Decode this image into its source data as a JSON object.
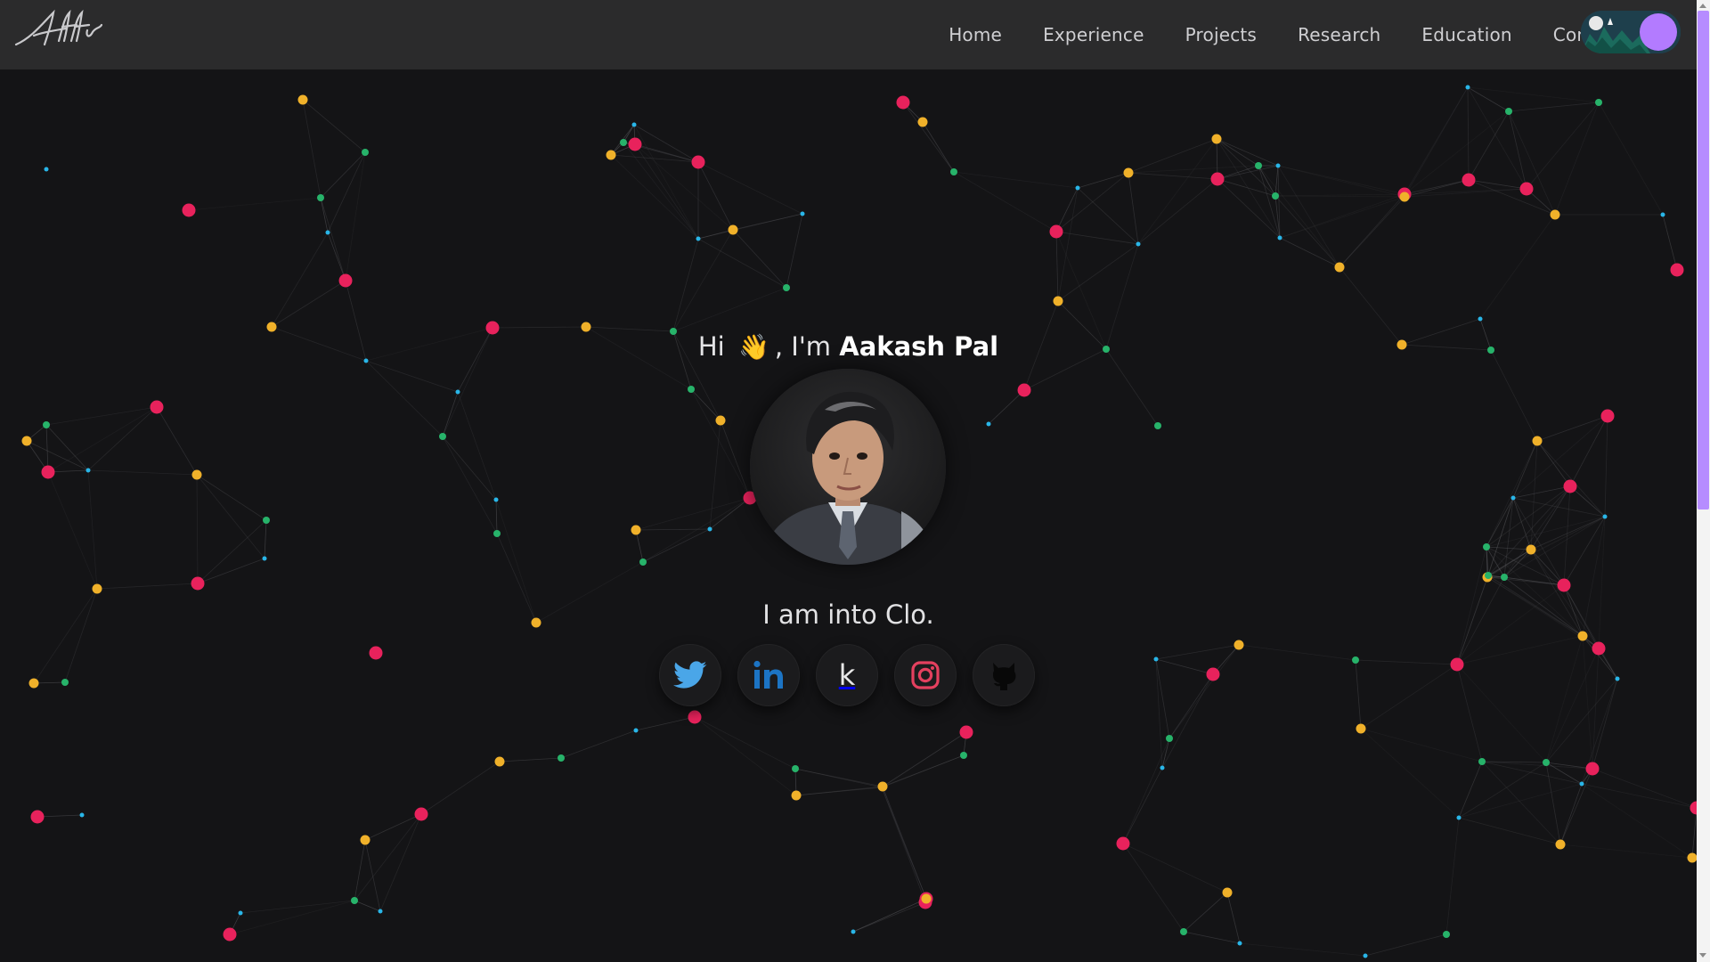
{
  "brand": {
    "logo_text": "Affi"
  },
  "nav": {
    "items": [
      "Home",
      "Experience",
      "Projects",
      "Research",
      "Education",
      "Contact"
    ]
  },
  "theme_toggle": {
    "state": "dark"
  },
  "hero": {
    "greeting_prefix": "Hi",
    "wave_emoji": "👋",
    "greeting_mid": ", I'm",
    "name": "Aakash Pal",
    "tagline": "I am into Clo."
  },
  "social": [
    {
      "name": "twitter",
      "icon": "twitter-icon"
    },
    {
      "name": "linkedin",
      "icon": "linkedin-icon"
    },
    {
      "name": "kaggle",
      "icon": "kaggle-icon",
      "glyph": "k"
    },
    {
      "name": "instagram",
      "icon": "instagram-icon"
    },
    {
      "name": "github",
      "icon": "github-icon"
    }
  ],
  "colors": {
    "background": "#141416",
    "navbar": "#2b2b2c",
    "accent": "#b37bff",
    "particle_green": "#27b36a",
    "particle_blue": "#29b6e8",
    "particle_red": "#e8225c",
    "particle_yellow": "#f0b12a"
  }
}
